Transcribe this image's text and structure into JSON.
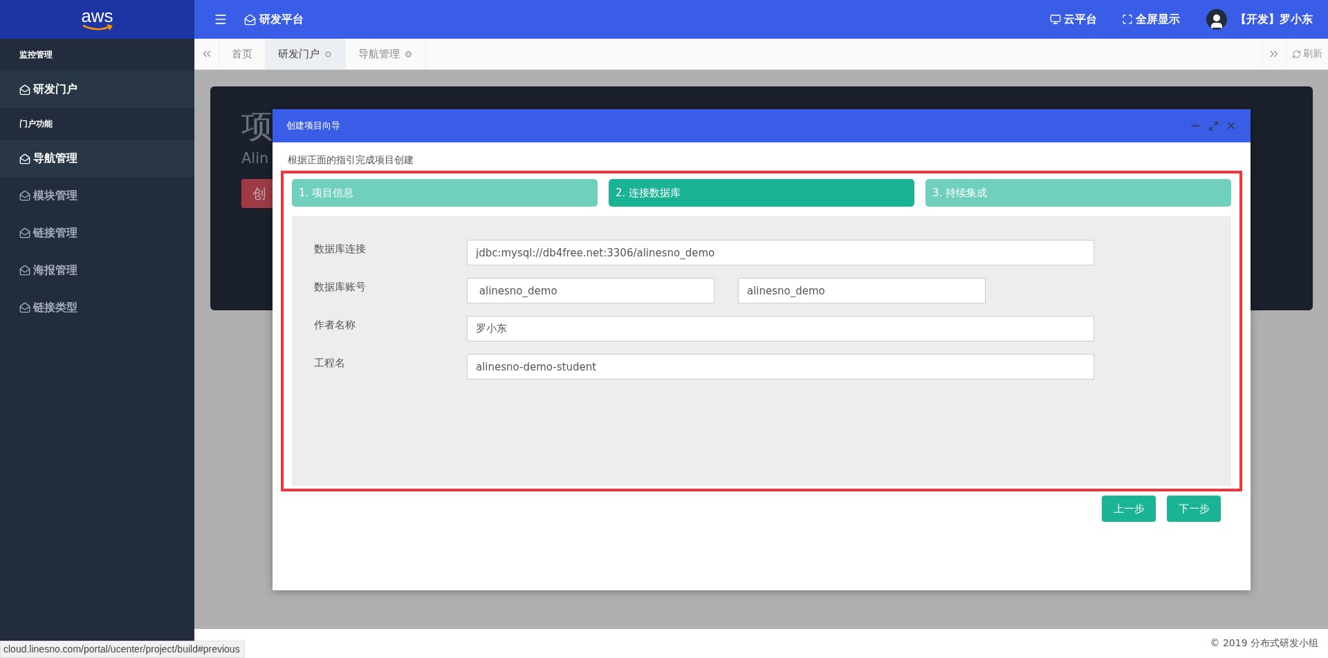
{
  "logo": "aws",
  "topbar": {
    "title": "研发平台",
    "links": [
      {
        "kind": "monitor",
        "label": "云平台"
      },
      {
        "kind": "fullscreen",
        "label": "全屏显示"
      }
    ],
    "user": "【开发】罗小东"
  },
  "sidebar": {
    "items": [
      {
        "kind": "header",
        "label": "监控管理"
      },
      {
        "kind": "item",
        "label": "研发门户",
        "selected": true
      },
      {
        "kind": "header",
        "label": "门户功能"
      },
      {
        "kind": "item",
        "label": "导航管理",
        "selected": true
      },
      {
        "kind": "item",
        "label": "模块管理",
        "selected": false
      },
      {
        "kind": "item",
        "label": "链接管理",
        "selected": false
      },
      {
        "kind": "item",
        "label": "海报管理",
        "selected": false
      },
      {
        "kind": "item",
        "label": "链接类型",
        "selected": false
      }
    ]
  },
  "tabs": [
    {
      "label": "首页",
      "selected": false,
      "closable": false
    },
    {
      "label": "研发门户",
      "selected": true,
      "closable": true
    },
    {
      "label": "导航管理",
      "selected": false,
      "closable": true
    }
  ],
  "refresh": "刷新",
  "background_card": {
    "heading": "项",
    "subtitle": "Alin",
    "button": "创"
  },
  "dialog": {
    "title": "创建项目向导",
    "intro": "根据正面的指引完成项目创建",
    "steps": [
      {
        "label": "1. 项目信息",
        "selected": false
      },
      {
        "label": "2. 连接数据库",
        "selected": true
      },
      {
        "label": "3. 持续集成",
        "selected": false
      }
    ],
    "fields": [
      {
        "label": "数据库连接",
        "values": [
          "jdbc:mysql://db4free.net:3306/alinesno_demo"
        ]
      },
      {
        "label": "数据库账号",
        "values": [
          " alinesno_demo",
          "alinesno_demo"
        ]
      },
      {
        "label": "作者名称",
        "values": [
          "罗小东"
        ]
      },
      {
        "label": "工程名",
        "values": [
          "alinesno-demo-student"
        ]
      }
    ],
    "buttons": [
      "上一步",
      "下一步"
    ]
  },
  "footer": "© 2019 分布式研发小组",
  "status_url": "cloud.linesno.com/portal/ucenter/project/build#previous"
}
